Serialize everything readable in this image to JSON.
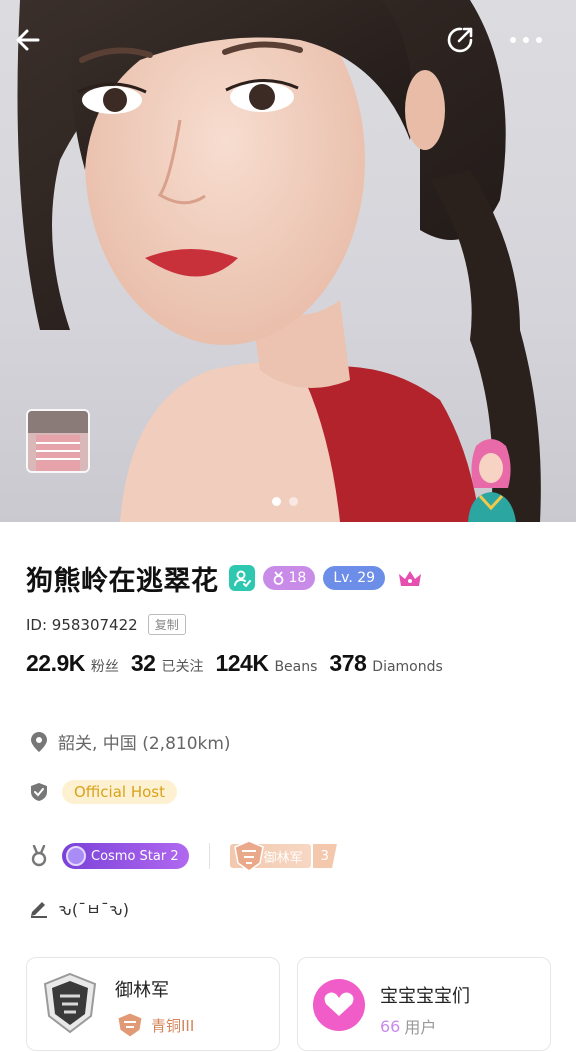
{
  "header": {
    "back_icon": "arrow-left-icon",
    "share_icon": "share-icon",
    "more_icon": "more-horizontal-icon"
  },
  "gallery": {
    "photo_count": 2,
    "active_index": 1
  },
  "profile": {
    "name": "狗熊岭在逃翠花",
    "age": "18",
    "level": "Lv. 29",
    "id_label": "ID: 958307422",
    "copy_label": "复制",
    "stats": [
      {
        "value": "22.9K",
        "label": "粉丝"
      },
      {
        "value": "32",
        "label": "已关注"
      },
      {
        "value": "124K",
        "label": "Beans"
      },
      {
        "value": "378",
        "label": "Diamonds"
      }
    ]
  },
  "info": {
    "location": "韶关, 中国 (2,810km)",
    "official_host": "Official Host",
    "cosmo_star": "Cosmo Star 2",
    "guard_name": "御林军",
    "guard_level": "3",
    "signature": "ԅ(¯ㅂ¯ԅ)"
  },
  "cards": {
    "left_title": "御林军",
    "left_sub": "青铜III",
    "left_emblem": "jin-yi-wei",
    "right_title": "宝宝宝宝们",
    "right_count": "66",
    "right_unit": "用户"
  },
  "colors": {
    "verified": "#2ec7b0",
    "age_badge": "#c98be8",
    "level_badge": "#6c8ee8",
    "crown": "#e44fb0",
    "host_tag_bg": "#fdf1d2",
    "host_tag_text": "#d9a21a",
    "cosmo": "#8a4fe0",
    "group_icon": "#f05cc8"
  }
}
